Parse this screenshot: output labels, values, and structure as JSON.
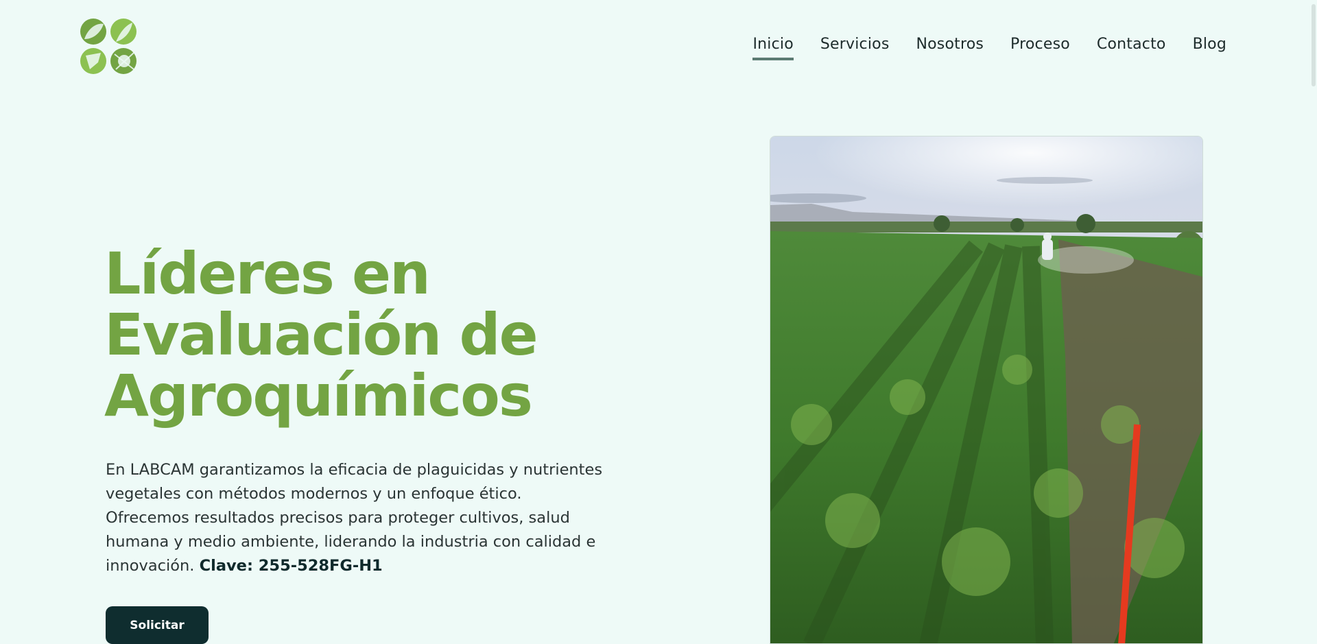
{
  "nav": {
    "items": [
      {
        "label": "Inicio",
        "active": true
      },
      {
        "label": "Servicios",
        "active": false
      },
      {
        "label": "Nosotros",
        "active": false
      },
      {
        "label": "Proceso",
        "active": false
      },
      {
        "label": "Contacto",
        "active": false
      },
      {
        "label": "Blog",
        "active": false
      }
    ]
  },
  "hero": {
    "title_line1": "Líderes en",
    "title_line2": "Evaluación de",
    "title_line3": "Agroquímicos",
    "description": "En LABCAM garantizamos la eficacia de plaguicidas y nutrientes vegetales con métodos modernos y un enfoque ético. Ofrecemos resultados precisos para proteger cultivos, salud humana y medio ambiente, liderando la industria con calidad e innovación.",
    "clave": "Clave: 255-528FG-H1",
    "cta_label": "Solicitar"
  },
  "colors": {
    "accent_green": "#73a443",
    "dark_teal": "#0f2d2f",
    "background": "#eefaf7"
  },
  "icons": {
    "logo": "leaf-clover-logo-icon"
  }
}
